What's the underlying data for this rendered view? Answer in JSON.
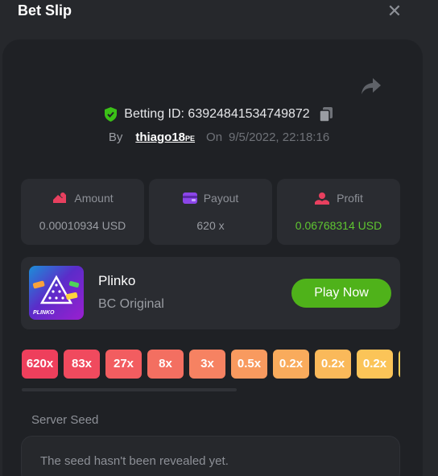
{
  "header": {
    "title": "Bet Slip",
    "close_icon": "close-icon"
  },
  "bet": {
    "id_label": "Betting ID: 63924841534749872",
    "by_label": "By",
    "username": "thiago18",
    "username_suffix": "PE",
    "on_label": "On",
    "date": "9/5/2022, 22:18:16"
  },
  "stats": [
    {
      "label": "Amount",
      "value": "0.00010934 USD",
      "icon": "amount-icon"
    },
    {
      "label": "Payout",
      "value": "620 x",
      "icon": "wallet-icon"
    },
    {
      "label": "Profit",
      "value": "0.06768314 USD",
      "icon": "profit-icon"
    }
  ],
  "game": {
    "thumb_label": "PLINKO",
    "name": "Plinko",
    "subtitle": "BC Original",
    "play_label": "Play Now"
  },
  "multipliers": [
    {
      "label": "620x",
      "color": "#ee3f5c"
    },
    {
      "label": "83x",
      "color": "#f04a5e"
    },
    {
      "label": "27x",
      "color": "#f25d60"
    },
    {
      "label": "8x",
      "color": "#f36f61"
    },
    {
      "label": "3x",
      "color": "#f68262"
    },
    {
      "label": "0.5x",
      "color": "#f89a5f"
    },
    {
      "label": "0.2x",
      "color": "#f9ab5c"
    },
    {
      "label": "0.2x",
      "color": "#fab95a"
    },
    {
      "label": "0.2x",
      "color": "#fbc458"
    },
    {
      "label": "",
      "color": "#fbcf58"
    }
  ],
  "seed": {
    "label": "Server Seed",
    "value": "The seed hasn't been revealed yet."
  },
  "colors": {
    "accent_green": "#4fb21a",
    "profit_green": "#5fc631",
    "shield_green": "#3bc117",
    "amount_icon": "#e8405f",
    "payout_icon": "#8b45e8"
  }
}
